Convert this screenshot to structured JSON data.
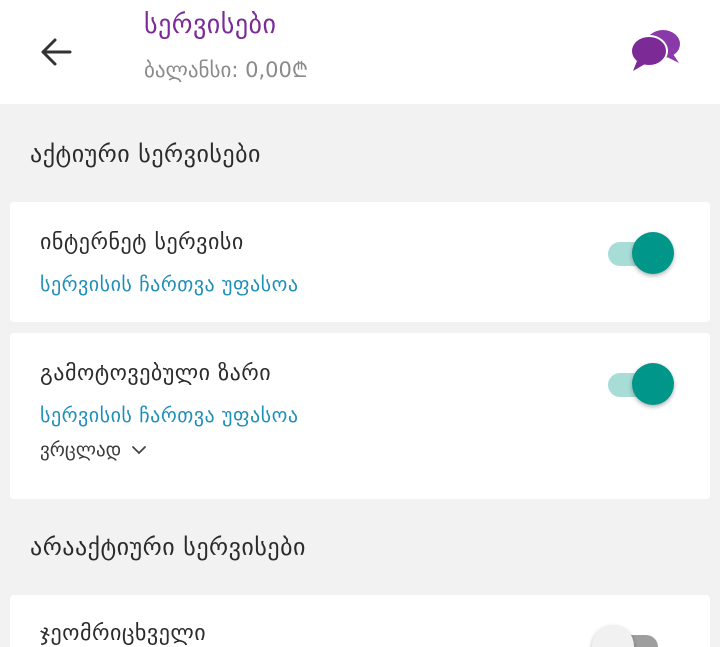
{
  "header": {
    "title": "სერვისები",
    "balance": "ბალანსი: 0,00₾",
    "back_icon": "arrow-left-icon",
    "chat_icon": "chat-bubbles-icon",
    "accent_color": "#7b2a96"
  },
  "sections": {
    "active_title": "აქტიური სერვისები",
    "inactive_title": "არააქტიური სერვისები"
  },
  "services": {
    "internet": {
      "title": "ინტერნეტ სერვისი",
      "link": "სერვისის ჩართვა უფასოა",
      "enabled": true
    },
    "missed_call": {
      "title": "გამოტოვებული ზარი",
      "link": "სერვისის ჩართვა უფასოა",
      "details_label": "ვრცლად",
      "enabled": true
    },
    "voicemail": {
      "title": "ჯეომრიცხველი",
      "enabled": false
    }
  },
  "colors": {
    "toggle_on": "#00968a",
    "toggle_on_track": "#a8dcd6",
    "link": "#1f8fb8"
  }
}
